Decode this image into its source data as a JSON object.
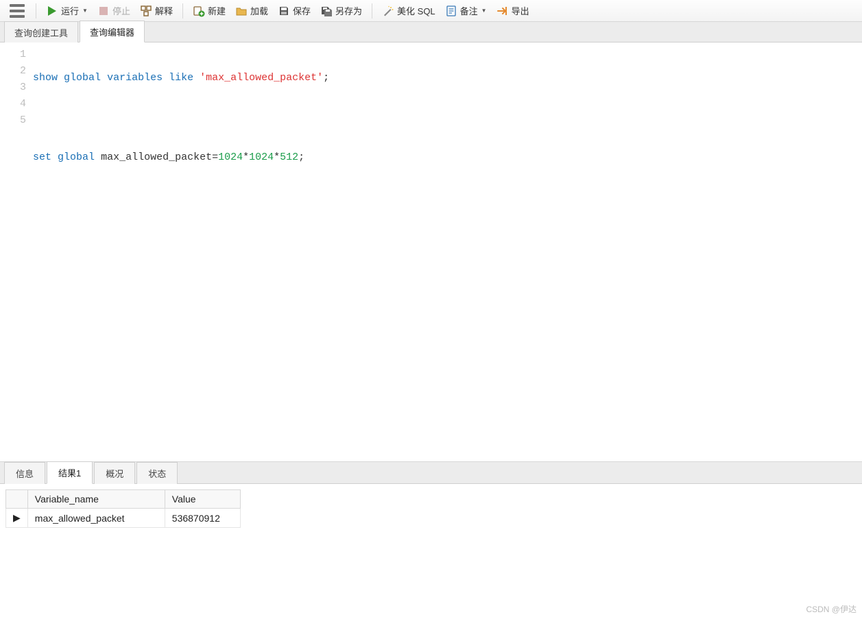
{
  "toolbar": {
    "run_label": "运行",
    "stop_label": "停止",
    "explain_label": "解释",
    "new_label": "新建",
    "load_label": "加载",
    "save_label": "保存",
    "saveas_label": "另存为",
    "beautify_label": "美化 SQL",
    "notes_label": "备注",
    "export_label": "导出"
  },
  "tabs_upper": {
    "builder": "查询创建工具",
    "editor": "查询编辑器"
  },
  "editor": {
    "lines": {
      "l1": {
        "kw1": "show",
        "kw2": "global",
        "kw3": "variables",
        "kw4": "like",
        "str": "'max_allowed_packet'",
        "tail": ";"
      },
      "l3": {
        "kw1": "set",
        "kw2": "global",
        "id": "max_allowed_packet=",
        "n1": "1024",
        "op1": "*",
        "n2": "1024",
        "op2": "*",
        "n3": "512",
        "tail": ";"
      }
    }
  },
  "tabs_lower": {
    "info": "信息",
    "result1": "结果1",
    "profile": "概况",
    "status": "状态"
  },
  "result": {
    "columns": {
      "c0": "Variable_name",
      "c1": "Value"
    },
    "row0": {
      "var": "max_allowed_packet",
      "val": "536870912"
    }
  },
  "watermark": "CSDN @伊达"
}
